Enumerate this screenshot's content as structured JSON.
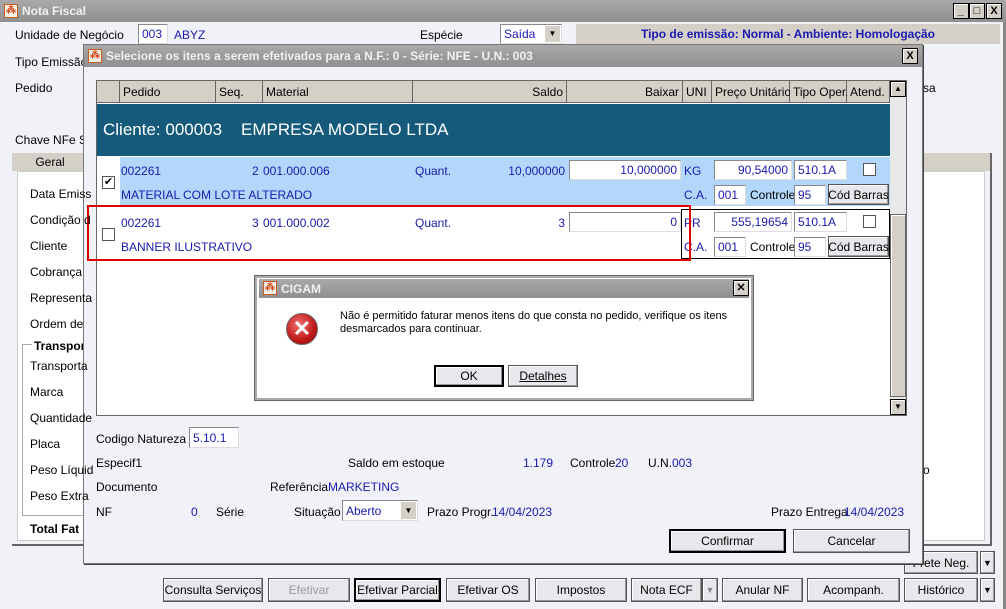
{
  "main": {
    "title": "Nota Fiscal",
    "unidade_label": "Unidade de Negócio",
    "unidade_code": "003",
    "unidade_name": "ABYZ",
    "especie_label": "Espécie",
    "especie_value": "Saída",
    "banner": "Tipo de emissão: Normal - Ambiente: Homologação",
    "tipo_emissao_label": "Tipo Emissão",
    "pedido_label": "Pedido",
    "chave_label": "Chave NFe SE",
    "right_fragment1": "sa",
    "right_fragment2": "o",
    "tab_geral": "Geral",
    "fields": [
      "Data Emiss",
      "Condição d",
      "Cliente",
      "Cobrança",
      "Representa",
      "Ordem de"
    ],
    "transporte_group": "Transpor",
    "transporte_fields": [
      "Transporta",
      "Marca",
      "Quantidade",
      "Placa",
      "Peso Líquid",
      "Peso Extra"
    ],
    "total_label": "Total Fat",
    "upper_buttons": [
      "Frete Neg."
    ],
    "buttons": [
      "Consulta Serviços",
      "Efetivar",
      "Efetivar Parcial",
      "Efetivar OS",
      "Impostos",
      "Nota ECF",
      "Anular NF",
      "Acompanh.",
      "Histórico"
    ]
  },
  "modal": {
    "title": "Selecione os itens a serem efetivados para a N.F.: 0 - Série: NFE - U.N.: 003",
    "columns": [
      "Pedido",
      "Seq.",
      "Material",
      "Saldo",
      "Baixar",
      "UNI",
      "Preço Unitário",
      "Tipo Oper.",
      "Atend."
    ],
    "cliente": "Cliente: 000003    EMPRESA MODELO LTDA",
    "rows": [
      {
        "checked": true,
        "pedido": "002261",
        "seq": "2",
        "material": "001.000.006",
        "qlabel": "Quant.",
        "saldo": "10,000000",
        "baixar": "10,000000",
        "uni": "KG",
        "preco": "90,54000",
        "tipo": "510.1A",
        "desc": "MATERIAL COM LOTE ALTERADO",
        "ca_label": "C.A.",
        "ca": "001",
        "controle_label": "Controle",
        "controle": "95",
        "barcode": "Cód Barras"
      },
      {
        "checked": false,
        "pedido": "002261",
        "seq": "3",
        "material": "001.000.002",
        "qlabel": "Quant.",
        "saldo": "3",
        "baixar": "0",
        "uni": "PR",
        "preco": "555,19654",
        "tipo": "510.1A",
        "desc": "BANNER ILUSTRATIVO",
        "ca_label": "C.A.",
        "ca": "001",
        "controle_label": "Controle",
        "controle": "95",
        "barcode": "Cód Barras"
      }
    ],
    "codigo_natureza_label": "Codigo Natureza",
    "codigo_natureza": "5.10.1",
    "especif_label": "Especif1",
    "saldo_estoque_label": "Saldo em estoque",
    "saldo_estoque": "1.179",
    "controle_label": "Controle",
    "controle": "20",
    "un_label": "U.N.",
    "un": "003",
    "documento_label": "Documento",
    "referencia_label": "Referência",
    "referencia": "MARKETING",
    "nf_label": "NF",
    "nf": "0",
    "serie_label": "Série",
    "situacao_label": "Situação",
    "situacao": "Aberto",
    "prazo_progr_label": "Prazo Progr.",
    "prazo_progr": "14/04/2023",
    "prazo_entrega_label": "Prazo Entrega",
    "prazo_entrega": "14/04/2023",
    "confirm": "Confirmar",
    "cancel": "Cancelar"
  },
  "dialog": {
    "title": "CIGAM",
    "message": "Não é permitido faturar menos itens do que consta no pedido, verifique os itens desmarcados para continuar.",
    "ok": "OK",
    "details": "Detalhes"
  }
}
